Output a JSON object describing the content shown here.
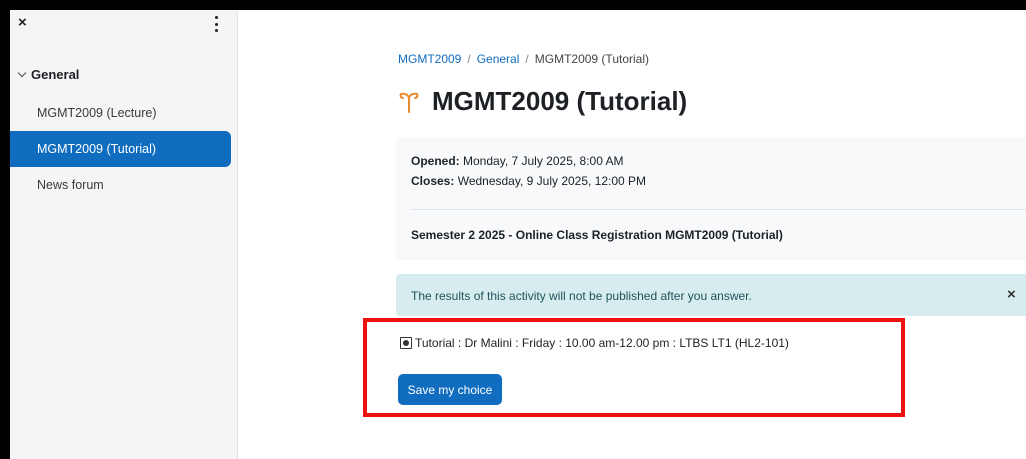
{
  "sidebar": {
    "close_glyph": "×",
    "section_label": "General",
    "items": [
      {
        "label": "MGMT2009 (Lecture)",
        "active": false
      },
      {
        "label": "MGMT2009 (Tutorial)",
        "active": true
      },
      {
        "label": "News forum",
        "active": false
      }
    ]
  },
  "breadcrumb": {
    "items": [
      "MGMT2009",
      "General",
      "MGMT2009 (Tutorial)"
    ],
    "separator": "/"
  },
  "page": {
    "title": "MGMT2009 (Tutorial)",
    "icon": "choice-icon"
  },
  "dates": {
    "opened_label": "Opened:",
    "opened_value": "Monday, 7 July 2025, 8:00 AM",
    "closes_label": "Closes:",
    "closes_value": "Wednesday, 9 July 2025, 12:00 PM"
  },
  "intro": "Semester 2 2025 - Online Class Registration MGMT2009 (Tutorial)",
  "alert": {
    "text": "The results of this activity will not be published after you answer.",
    "close_glyph": "×"
  },
  "choice": {
    "option_label": "Tutorial : Dr Malini : Friday : 10.00 am-12.00 pm : LTBS LT1 (HL2-101)",
    "selected": true,
    "save_label": "Save my choice"
  },
  "colors": {
    "accent": "#0f6cbf",
    "icon": "#e88a2e",
    "alert_bg": "#d6ecee",
    "highlight": "#ee1111"
  }
}
